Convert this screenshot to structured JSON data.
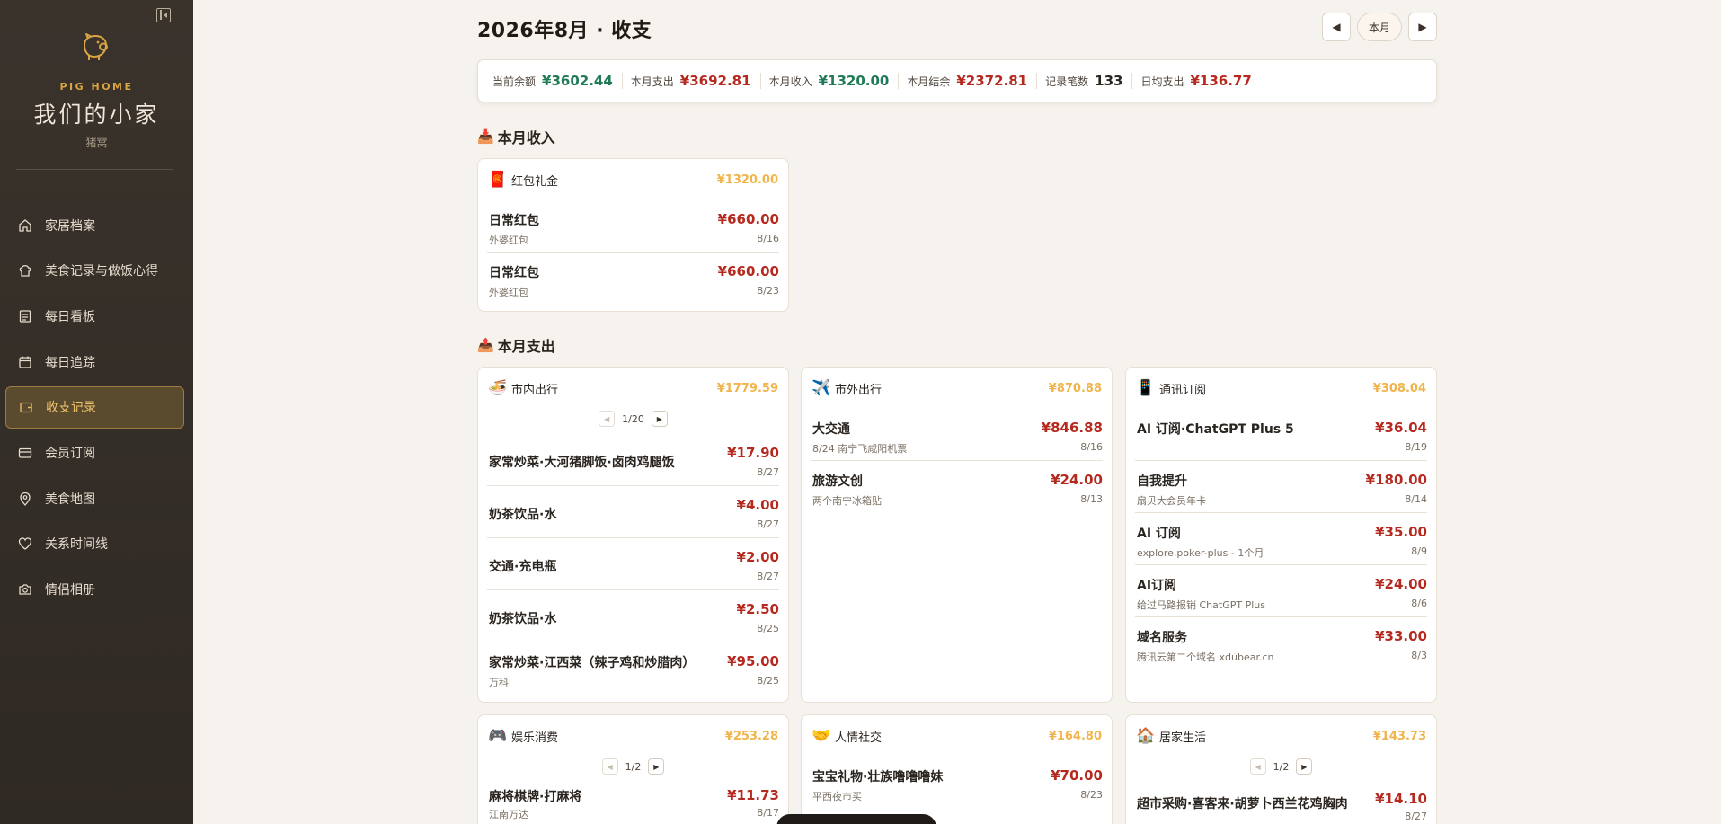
{
  "sidebar": {
    "brand_en": "PIG HOME",
    "brand_cn": "我们的小家",
    "brand_sub": "猪窝",
    "items": [
      {
        "label": "家居档案",
        "icon": "home-icon"
      },
      {
        "label": "美食记录与做饭心得",
        "icon": "chef-icon"
      },
      {
        "label": "每日看板",
        "icon": "board-icon"
      },
      {
        "label": "每日追踪",
        "icon": "calendar-icon"
      },
      {
        "label": "收支记录",
        "icon": "wallet-icon",
        "active": true
      },
      {
        "label": "会员订阅",
        "icon": "card-icon"
      },
      {
        "label": "美食地图",
        "icon": "pin-icon"
      },
      {
        "label": "关系时间线",
        "icon": "heart-icon"
      },
      {
        "label": "情侣相册",
        "icon": "camera-icon"
      }
    ]
  },
  "header": {
    "title": "2026年8月 · 收支",
    "prev": "◀",
    "current": "本月",
    "next": "▶"
  },
  "summary": [
    {
      "label": "当前余额",
      "value": "¥3602.44",
      "tone": "green"
    },
    {
      "label": "本月支出",
      "value": "¥3692.81",
      "tone": "red"
    },
    {
      "label": "本月收入",
      "value": "¥1320.00",
      "tone": "green"
    },
    {
      "label": "本月结余",
      "value": "¥2372.81",
      "tone": "red"
    },
    {
      "label": "记录笔数",
      "value": "133",
      "tone": "dark"
    },
    {
      "label": "日均支出",
      "value": "¥136.77",
      "tone": "red"
    }
  ],
  "income": {
    "title": "本月收入",
    "icon": "📥",
    "cards": [
      {
        "emoji": "🧧",
        "title": "红包礼金",
        "total": "¥1320.00",
        "entries": [
          {
            "name": "日常红包",
            "sub": "外婆红包",
            "amount": "¥660.00",
            "date": "8/16"
          },
          {
            "name": "日常红包",
            "sub": "外婆红包",
            "amount": "¥660.00",
            "date": "8/23"
          }
        ]
      }
    ]
  },
  "expense": {
    "title": "本月支出",
    "icon": "📤",
    "cards": [
      {
        "emoji": "🍜",
        "title": "市内出行",
        "total": "¥1779.59",
        "page": "1/20",
        "entries": [
          {
            "name": "家常炒菜·大河猪脚饭·卤肉鸡腿饭",
            "sub": "",
            "amount": "¥17.90",
            "date": "8/27"
          },
          {
            "name": "奶茶饮品·水",
            "sub": "",
            "amount": "¥4.00",
            "date": "8/27"
          },
          {
            "name": "交通·充电瓶",
            "sub": "",
            "amount": "¥2.00",
            "date": "8/27"
          },
          {
            "name": "奶茶饮品·水",
            "sub": "",
            "amount": "¥2.50",
            "date": "8/25"
          },
          {
            "name": "家常炒菜·江西菜（辣子鸡和炒腊肉）",
            "sub": "万科",
            "amount": "¥95.00",
            "date": "8/25"
          }
        ]
      },
      {
        "emoji": "✈️",
        "title": "市外出行",
        "total": "¥870.88",
        "entries": [
          {
            "name": "大交通",
            "sub": "8/24 南宁飞咸阳机票",
            "amount": "¥846.88",
            "date": "8/16"
          },
          {
            "name": "旅游文创",
            "sub": "两个南宁冰箱贴",
            "amount": "¥24.00",
            "date": "8/13"
          }
        ]
      },
      {
        "emoji": "📱",
        "title": "通讯订阅",
        "total": "¥308.04",
        "entries": [
          {
            "name": "AI 订阅·ChatGPT Plus 5",
            "sub": "",
            "amount": "¥36.04",
            "date": "8/19"
          },
          {
            "name": "自我提升",
            "sub": "扇贝大会员年卡",
            "amount": "¥180.00",
            "date": "8/14"
          },
          {
            "name": "AI 订阅",
            "sub": "explore.poker-plus - 1个月",
            "amount": "¥35.00",
            "date": "8/9"
          },
          {
            "name": "AI订阅",
            "sub": "给过马路报销 ChatGPT Plus",
            "amount": "¥24.00",
            "date": "8/6"
          },
          {
            "name": "域名服务",
            "sub": "腾讯云第二个域名 xdubear.cn",
            "amount": "¥33.00",
            "date": "8/3"
          }
        ]
      },
      {
        "emoji": "🎮",
        "title": "娱乐消费",
        "total": "¥253.28",
        "page": "1/2",
        "entries": [
          {
            "name": "麻将棋牌·打麻将",
            "sub": "江南万达",
            "amount": "¥11.73",
            "date": "8/17"
          }
        ]
      },
      {
        "emoji": "🤝",
        "title": "人情社交",
        "total": "¥164.80",
        "entries": [
          {
            "name": "宝宝礼物·壮族噜噜噜妹",
            "sub": "平西夜市买",
            "amount": "¥70.00",
            "date": "8/23"
          }
        ]
      },
      {
        "emoji": "🏠",
        "title": "居家生活",
        "total": "¥143.73",
        "page": "1/2",
        "entries": [
          {
            "name": "超市采购·喜客来·胡萝卜西兰花鸡胸肉",
            "sub": "",
            "amount": "¥14.10",
            "date": "8/27"
          }
        ]
      }
    ]
  }
}
